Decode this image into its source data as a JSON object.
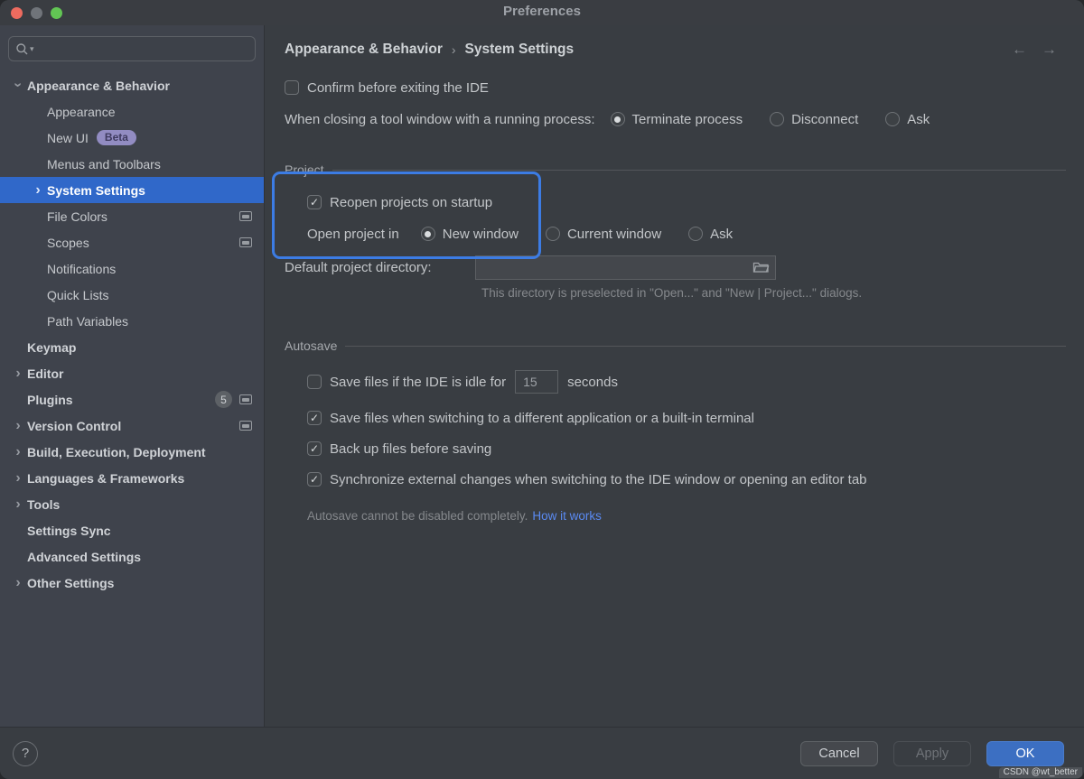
{
  "window": {
    "title": "Preferences"
  },
  "colors": {
    "selection_blue": "#3068c9",
    "annotation_blue": "#3c7ce4",
    "link_blue": "#5a8af2",
    "ok_button_blue": "#3c6fc2",
    "beta_badge_purple": "#928cc2"
  },
  "sidebar": {
    "search": {
      "placeholder": ""
    },
    "items": [
      {
        "label": "Appearance & Behavior",
        "level": "top",
        "chevron": "down"
      },
      {
        "label": "Appearance",
        "level": "child"
      },
      {
        "label": "New UI",
        "level": "child",
        "beta": "Beta"
      },
      {
        "label": "Menus and Toolbars",
        "level": "child"
      },
      {
        "label": "System Settings",
        "level": "child",
        "chevron": "right",
        "selected": true
      },
      {
        "label": "File Colors",
        "level": "child",
        "winicon": true
      },
      {
        "label": "Scopes",
        "level": "child",
        "winicon": true
      },
      {
        "label": "Notifications",
        "level": "child"
      },
      {
        "label": "Quick Lists",
        "level": "child"
      },
      {
        "label": "Path Variables",
        "level": "child"
      },
      {
        "label": "Keymap",
        "level": "top"
      },
      {
        "label": "Editor",
        "level": "top",
        "chevron": "right"
      },
      {
        "label": "Plugins",
        "level": "top",
        "count": "5",
        "winicon": true
      },
      {
        "label": "Version Control",
        "level": "top",
        "chevron": "right",
        "winicon": true
      },
      {
        "label": "Build, Execution, Deployment",
        "level": "top",
        "chevron": "right"
      },
      {
        "label": "Languages & Frameworks",
        "level": "top",
        "chevron": "right"
      },
      {
        "label": "Tools",
        "level": "top",
        "chevron": "right"
      },
      {
        "label": "Settings Sync",
        "level": "top"
      },
      {
        "label": "Advanced Settings",
        "level": "top"
      },
      {
        "label": "Other Settings",
        "level": "top",
        "chevron": "right"
      }
    ]
  },
  "header": {
    "breadcrumb": [
      "Appearance & Behavior",
      "System Settings"
    ],
    "separator": "›"
  },
  "general": {
    "confirm_exit": {
      "label": "Confirm before exiting the IDE",
      "checked": false
    },
    "closing": {
      "label": "When closing a tool window with a running process:",
      "options": [
        {
          "label": "Terminate process",
          "selected": true
        },
        {
          "label": "Disconnect",
          "selected": false
        },
        {
          "label": "Ask",
          "selected": false
        }
      ]
    }
  },
  "project": {
    "title": "Project",
    "reopen": {
      "label": "Reopen projects on startup",
      "checked": true
    },
    "open_in": {
      "label": "Open project in",
      "options": [
        {
          "label": "New window",
          "selected": true
        },
        {
          "label": "Current window",
          "selected": false
        },
        {
          "label": "Ask",
          "selected": false
        }
      ]
    },
    "default_dir": {
      "label": "Default project directory:",
      "value": "",
      "hint": "This directory is preselected in \"Open...\" and \"New | Project...\" dialogs."
    }
  },
  "autosave": {
    "title": "Autosave",
    "idle": {
      "checked": false,
      "label_before": "Save files if the IDE is idle for",
      "value": "15",
      "label_after": "seconds"
    },
    "checks": [
      {
        "label": "Save files when switching to a different application or a built-in terminal",
        "checked": true
      },
      {
        "label": "Back up files before saving",
        "checked": true
      },
      {
        "label": "Synchronize external changes when switching to the IDE window or opening an editor tab",
        "checked": true
      }
    ],
    "note": "Autosave cannot be disabled completely.",
    "note_link": "How it works"
  },
  "footer": {
    "help": "?",
    "cancel": "Cancel",
    "apply": "Apply",
    "ok": "OK"
  },
  "watermark": "CSDN @wt_better"
}
